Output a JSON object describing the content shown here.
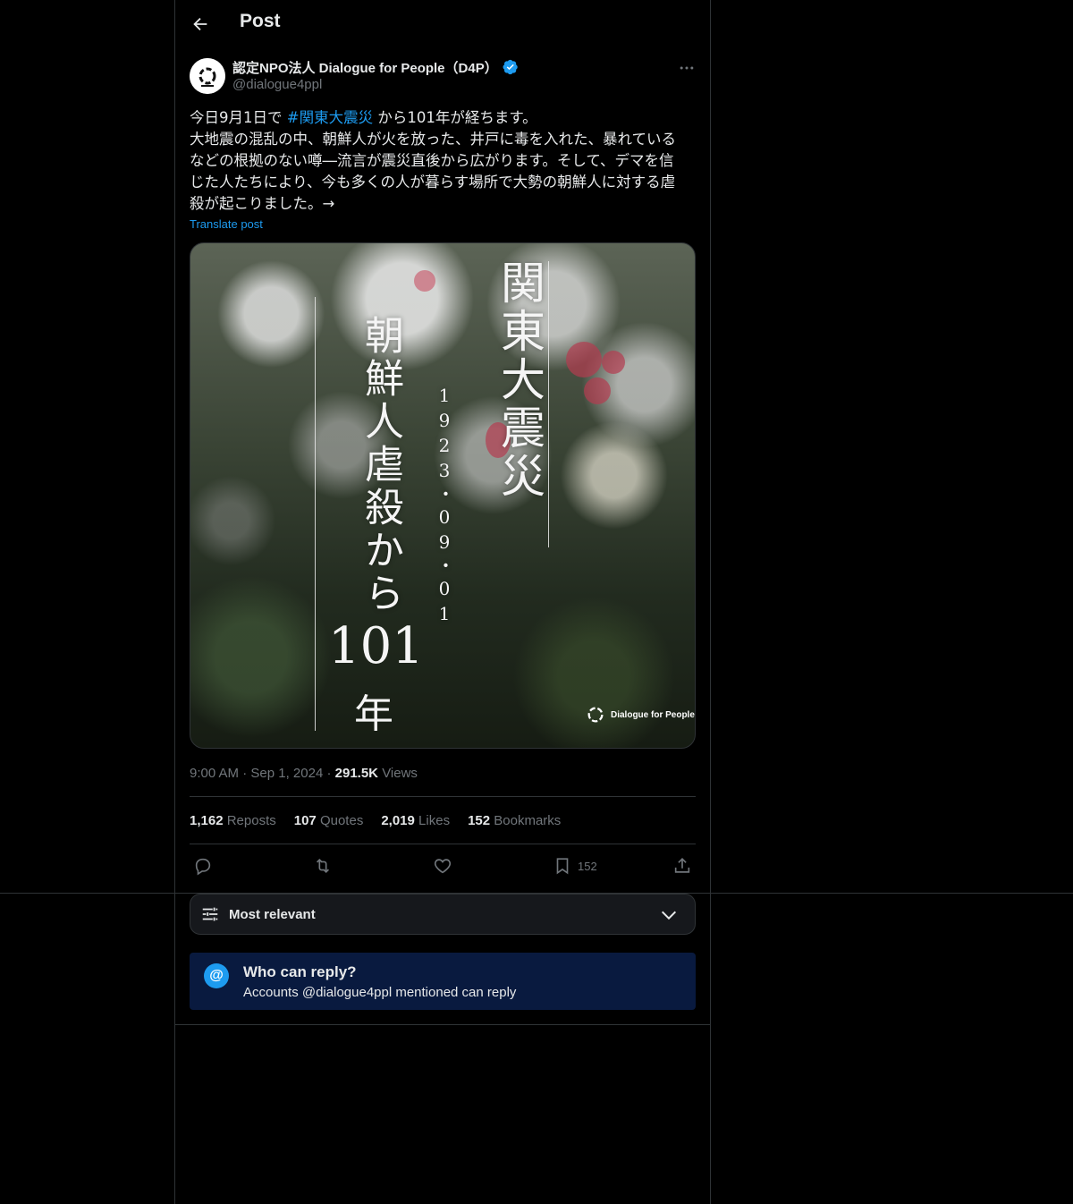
{
  "header": {
    "title": "Post",
    "back_icon": "arrow-left-icon"
  },
  "author": {
    "name": "認定NPO法人 Dialogue for People（D4P）",
    "handle": "@dialogue4ppl",
    "verified": true,
    "verified_color": "#1d9bf0"
  },
  "post": {
    "line1_pre": "今日9月1日で",
    "hashtag": "#関東大震災",
    "line1_post": "から101年が経ちます。",
    "line2": "大地震の混乱の中、朝鮮人が火を放った、井戸に毒を入れた、暴れている",
    "line3": "などの根拠のない噂―流言が震災直後から広がります。そして、デマを信",
    "line4": "じた人たちにより、今も多くの人が暮らす場所で大勢の朝鮮人に対する虐",
    "line5": "殺が起こりました。→",
    "translate": "Translate post"
  },
  "media": {
    "title_vertical": "関東大震災",
    "date_vertical": "1923・09・01",
    "subtitle_vertical": "朝鮮人虐殺から",
    "number": "101",
    "year_char": "年",
    "logo_text": "Dialogue for People"
  },
  "meta": {
    "time": "9:00 AM",
    "date": "Sep 1, 2024",
    "views_count": "291.5K",
    "views_label": "Views"
  },
  "stats": {
    "reposts_count": "1,162",
    "reposts_label": "Reposts",
    "quotes_count": "107",
    "quotes_label": "Quotes",
    "likes_count": "2,019",
    "likes_label": "Likes",
    "bookmarks_count": "152",
    "bookmarks_label": "Bookmarks"
  },
  "actions": {
    "reply_icon": "reply-icon",
    "repost_icon": "repost-icon",
    "like_icon": "heart-icon",
    "bookmark_icon": "bookmark-icon",
    "bookmark_count": "152",
    "share_icon": "share-icon"
  },
  "sort": {
    "label": "Most relevant"
  },
  "reply_restriction": {
    "title": "Who can reply?",
    "description": "Accounts @dialogue4ppl mentioned can reply",
    "accent": "#1d9bf0"
  }
}
